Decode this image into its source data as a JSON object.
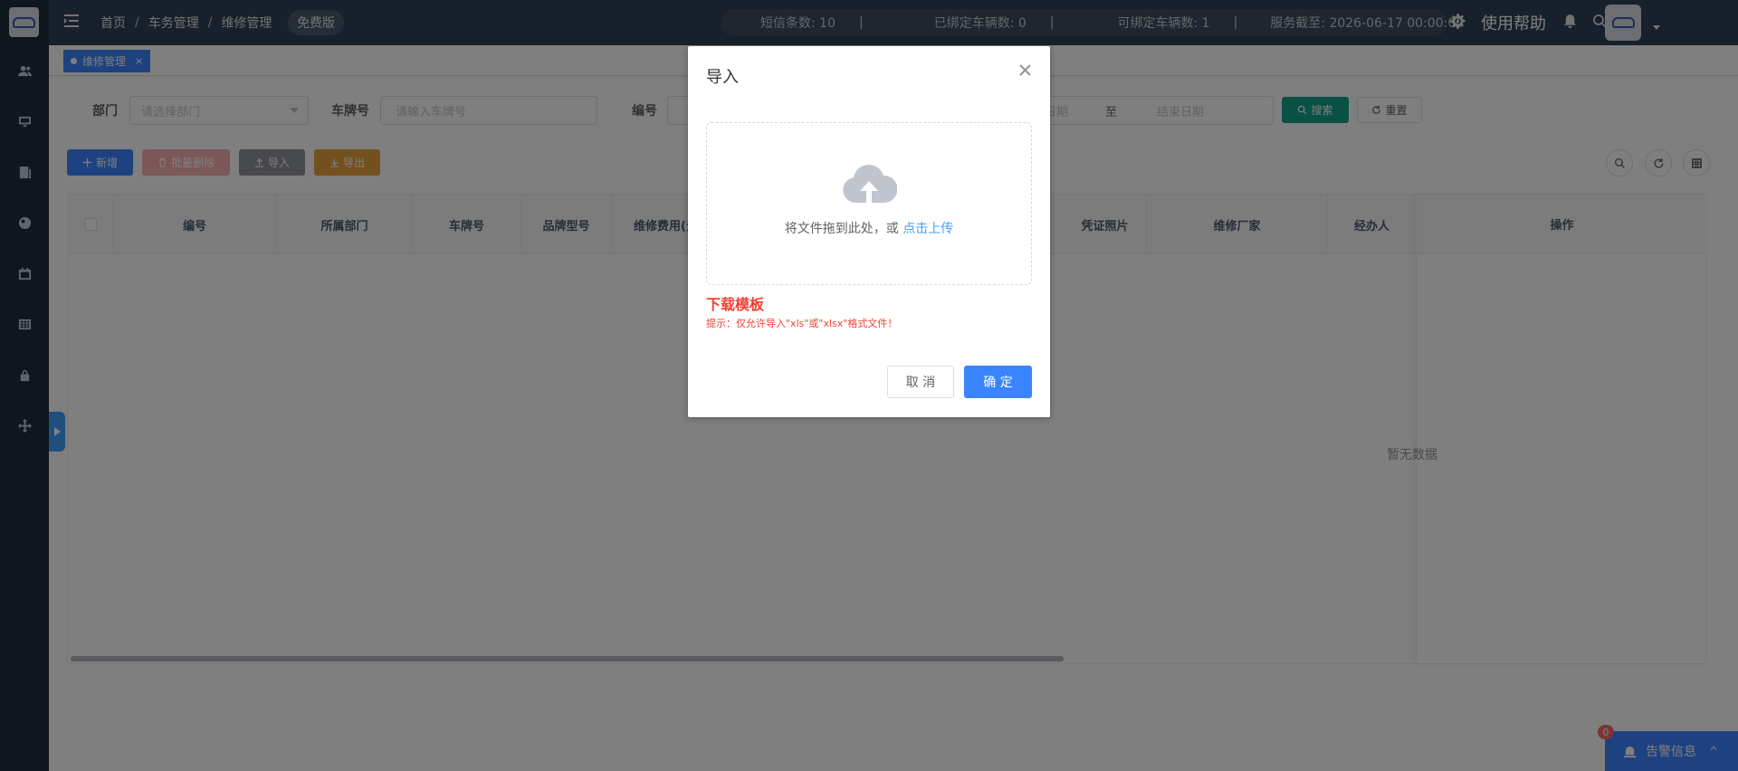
{
  "header": {
    "breadcrumb": [
      "首页",
      "车务管理",
      "维修管理"
    ],
    "breadcrumb_sep": "/",
    "plan_badge": "免费版",
    "stats": {
      "sms": "短信条数: 10",
      "bound": "已绑定车辆数: 0",
      "bindable": "可绑定车辆数: 1",
      "service_until": "服务截至: 2026-06-17 00:00:00"
    },
    "stats_sep": "|",
    "help": "使用帮助"
  },
  "tags": {
    "active": "维修管理",
    "close": "×"
  },
  "search": {
    "dept_label": "部门",
    "dept_placeholder": "请选择部门",
    "plate_label": "车牌号",
    "plate_placeholder": "请输入车牌号",
    "code_label": "编号",
    "start_date_placeholder": "日期",
    "range_sep": "至",
    "end_date_placeholder": "结束日期",
    "search_btn": "搜索",
    "reset_btn": "重置"
  },
  "toolbar": {
    "add": "新增",
    "batch_delete": "批量删除",
    "import": "导入",
    "export": "导出"
  },
  "table": {
    "columns": [
      "编号",
      "所属部门",
      "车牌号",
      "品牌型号",
      "维修费用(元",
      "凭证照片",
      "维修厂家",
      "经办人",
      "操作"
    ],
    "empty_text": "暂无数据"
  },
  "alert": {
    "count": "0",
    "label": "告警信息",
    "chevron": "^"
  },
  "dialog": {
    "title": "导入",
    "drop_text": "将文件拖到此处，或",
    "drop_link": "点击上传",
    "download_template": "下载模板",
    "tip": "提示：仅允许导入\"xls\"或\"xlsx\"格式文件！",
    "cancel": "取 消",
    "confirm": "确 定"
  },
  "colors": {
    "sidebar": "#1f2d3d",
    "topbar": "#304156",
    "primary": "#3a84ff",
    "danger": "#f56c6c",
    "warning": "#e6a23c",
    "teal": "#13a08a",
    "info": "#909399"
  }
}
